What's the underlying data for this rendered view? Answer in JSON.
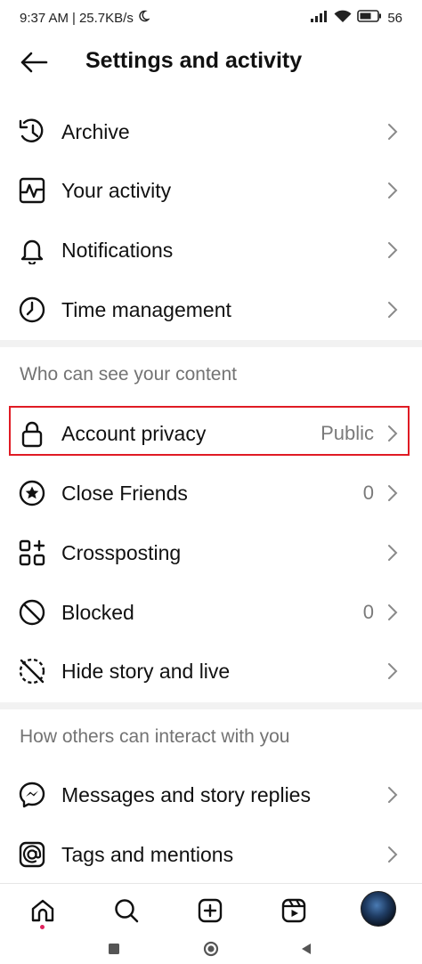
{
  "status_bar": {
    "time": "9:37 AM",
    "speed": "25.7KB/s",
    "battery": "56"
  },
  "header": {
    "title": "Settings and activity"
  },
  "top_items": [
    {
      "label": "Archive",
      "icon": "archive-icon"
    },
    {
      "label": "Your activity",
      "icon": "activity-icon"
    },
    {
      "label": "Notifications",
      "icon": "bell-icon"
    },
    {
      "label": "Time management",
      "icon": "clock-icon"
    }
  ],
  "section_visibility": {
    "title": "Who can see your content",
    "items": [
      {
        "label": "Account privacy",
        "value": "Public",
        "icon": "lock-icon"
      },
      {
        "label": "Close Friends",
        "value": "0",
        "icon": "star-circle-icon"
      },
      {
        "label": "Crossposting",
        "value": "",
        "icon": "crosspost-icon"
      },
      {
        "label": "Blocked",
        "value": "0",
        "icon": "blocked-icon"
      },
      {
        "label": "Hide story and live",
        "value": "",
        "icon": "hide-story-icon"
      }
    ]
  },
  "section_interaction": {
    "title": "How others can interact with you",
    "items": [
      {
        "label": "Messages and story replies",
        "icon": "messenger-icon"
      },
      {
        "label": "Tags and mentions",
        "icon": "at-icon"
      }
    ]
  },
  "colors": {
    "highlight": "#e01b24",
    "secondary_text": "#737373",
    "notification_dot": "#e0245e"
  }
}
